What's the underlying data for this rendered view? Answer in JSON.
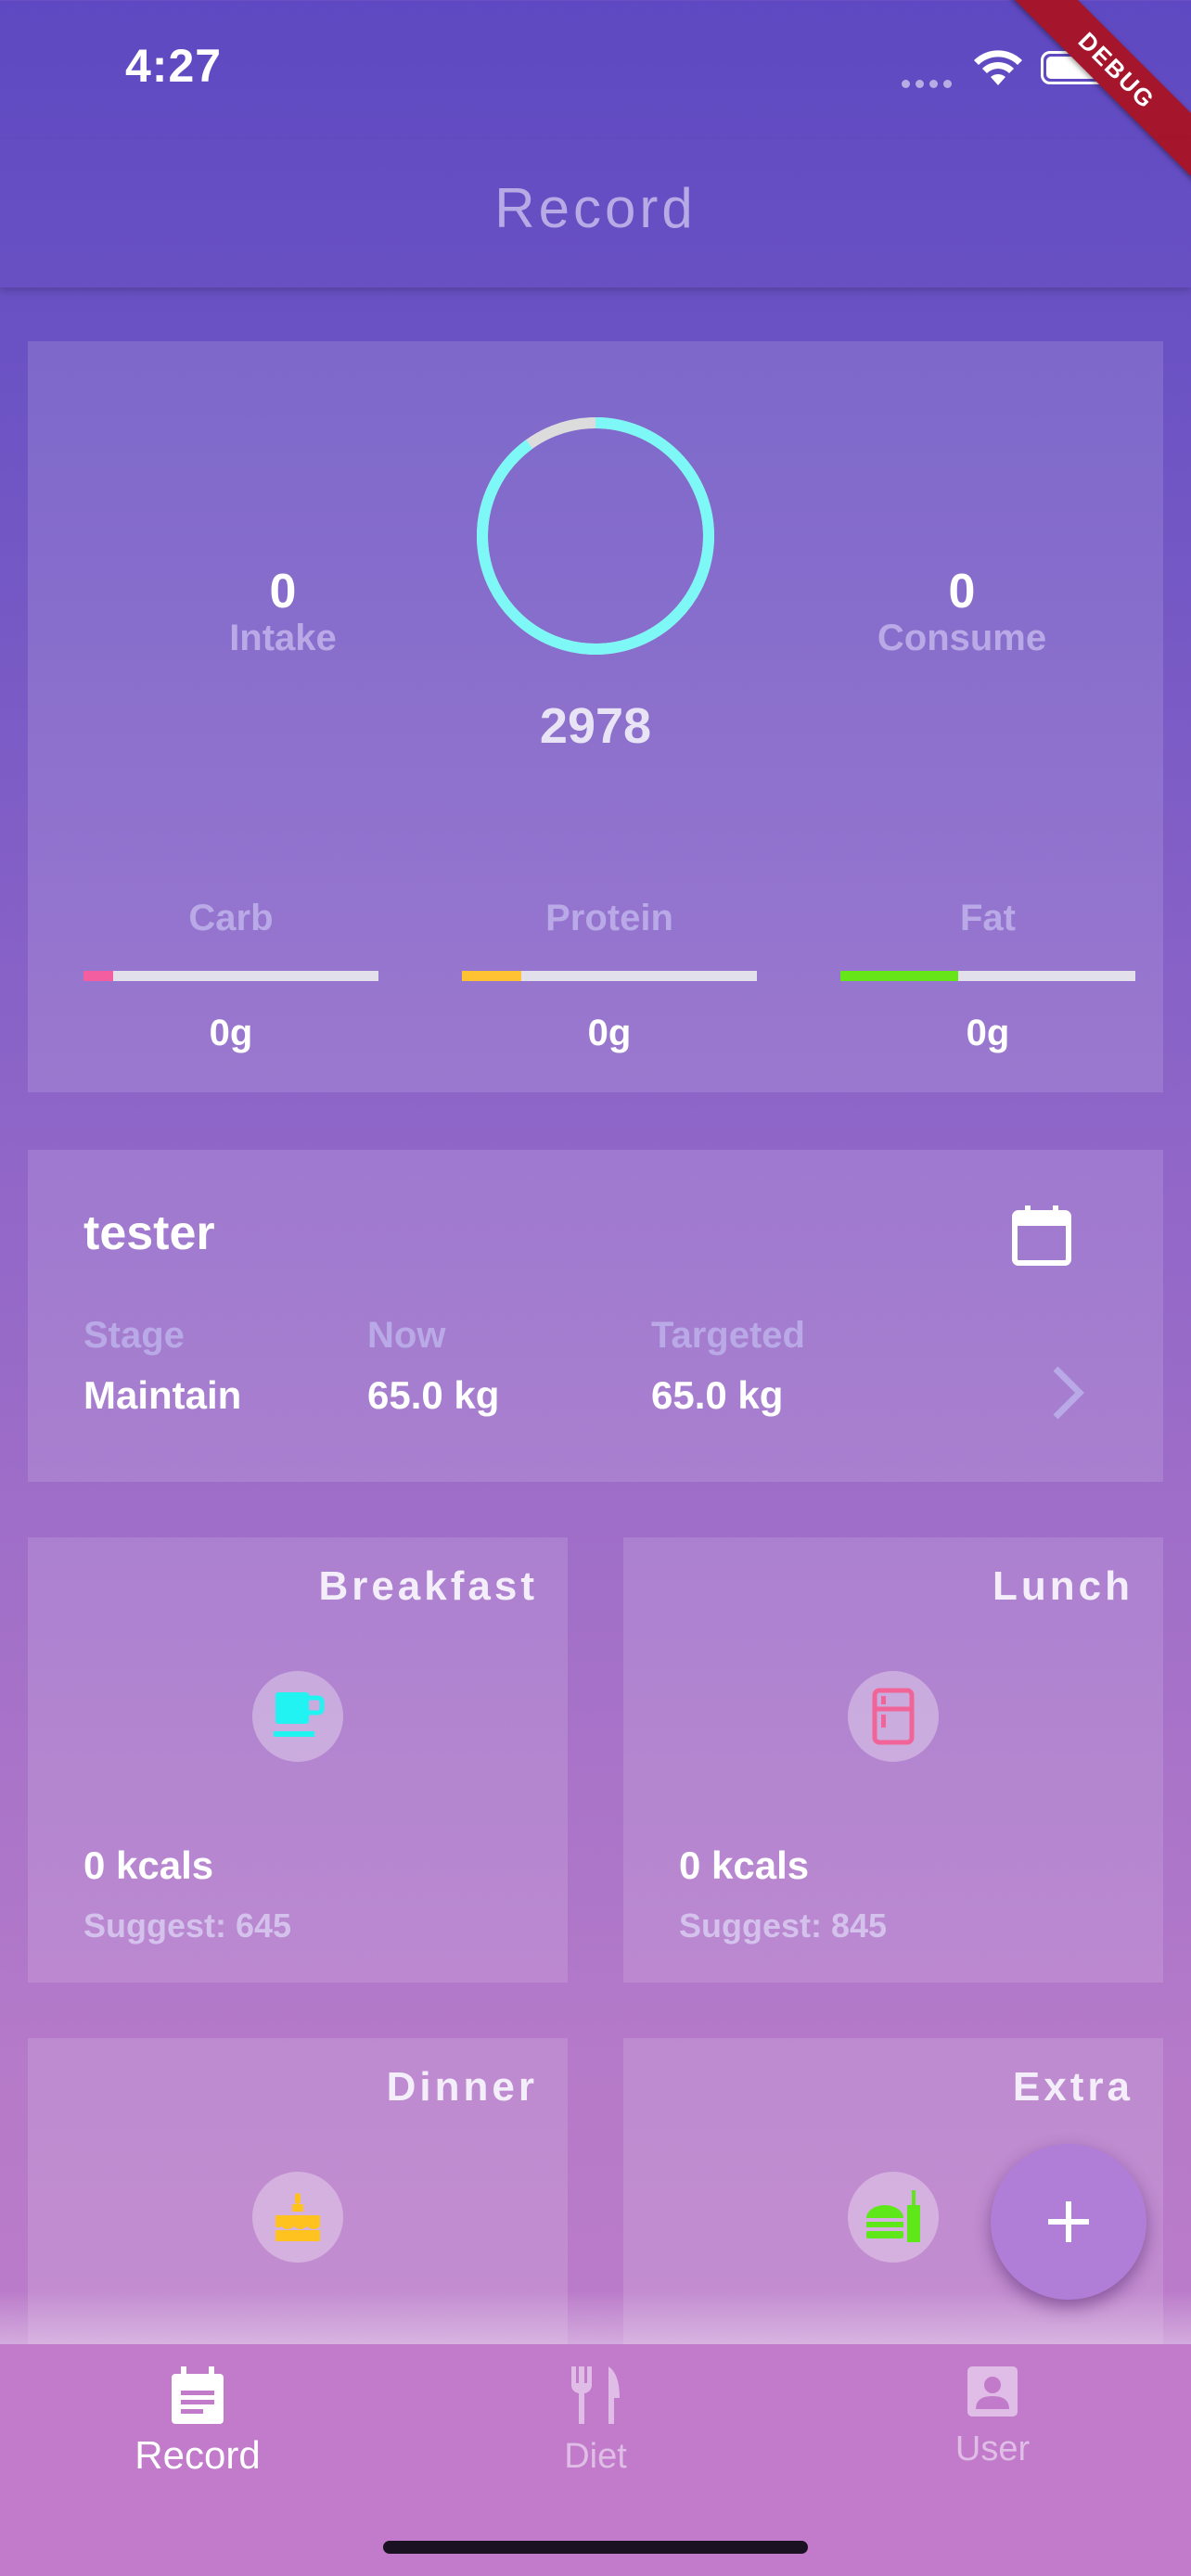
{
  "status_bar": {
    "time": "4:27",
    "debug_label": "DEBUG"
  },
  "app_bar": {
    "title": "Record"
  },
  "summary": {
    "intake_value": "0",
    "intake_label": "Intake",
    "consume_value": "0",
    "consume_label": "Consume",
    "remaining": "2978",
    "ring_color": "#7ef7f7",
    "ring_track_color": "#dcdcdc",
    "macros": [
      {
        "label": "Carb",
        "value": "0g",
        "color": "#f25ea0",
        "fill_fraction": 0.1
      },
      {
        "label": "Protein",
        "value": "0g",
        "color": "#ffc233",
        "fill_fraction": 0.2
      },
      {
        "label": "Fat",
        "value": "0g",
        "color": "#66e619",
        "fill_fraction": 0.4
      }
    ]
  },
  "profile": {
    "name": "tester",
    "stage_label": "Stage",
    "stage_value": "Maintain",
    "now_label": "Now",
    "now_value": "65.0 kg",
    "target_label": "Targeted",
    "target_value": "65.0 kg"
  },
  "meals": [
    {
      "title": "Breakfast",
      "kcal": "0 kcals",
      "suggest": "Suggest: 645",
      "icon": "coffee-cup-icon",
      "icon_color": "#21f2f2"
    },
    {
      "title": "Lunch",
      "kcal": "0 kcals",
      "suggest": "Suggest: 845",
      "icon": "fridge-icon",
      "icon_color": "#f06497"
    },
    {
      "title": "Dinner",
      "icon": "cake-icon",
      "icon_color": "#ffc21f"
    },
    {
      "title": "Extra",
      "icon": "fast-food-icon",
      "icon_color": "#5ee81a"
    }
  ],
  "fab": {
    "icon": "plus-icon"
  },
  "bottom_nav": [
    {
      "label": "Record",
      "icon": "calendar-note-icon",
      "active": true
    },
    {
      "label": "Diet",
      "icon": "fork-knife-icon",
      "active": false
    },
    {
      "label": "User",
      "icon": "user-card-icon",
      "active": false
    }
  ]
}
